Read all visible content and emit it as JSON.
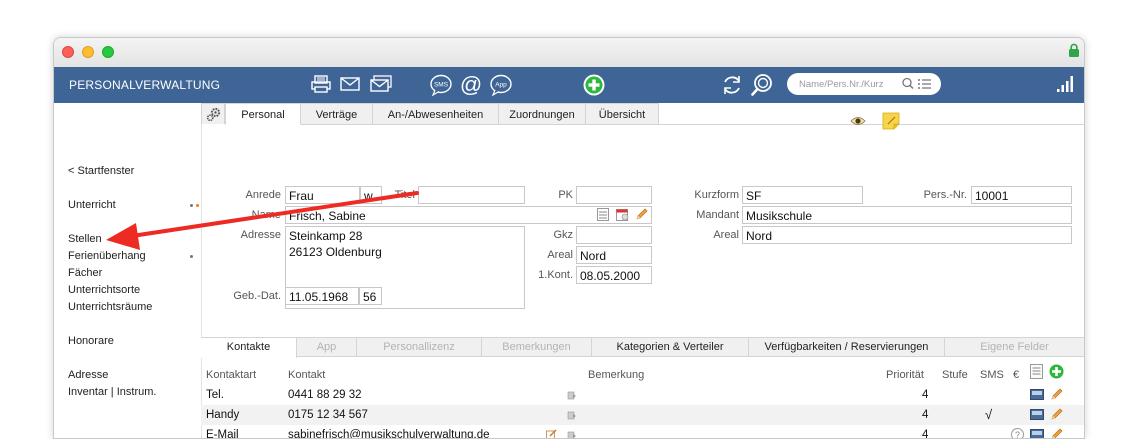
{
  "app": {
    "title": "PERSONALVERWALTUNG",
    "search_placeholder": "Name/Pers.Nr./Kurz"
  },
  "toolbar_icons": [
    "printer-icon",
    "envelope-icon",
    "envelopes-icon",
    "sms-icon",
    "at-icon",
    "app-icon",
    "add-icon",
    "refresh-icon",
    "magnifier-icon"
  ],
  "sidebar": {
    "back": "< Startfenster",
    "items": [
      "Unterricht",
      "Stellen",
      "Ferienüberhang",
      "Fächer",
      "Unterrichtsorte",
      "Unterrichtsräume",
      "Honorare",
      "Adresse",
      "Inventar | Instrum."
    ]
  },
  "tabs": [
    "Personal",
    "Verträge",
    "An-/Abwesenheiten",
    "Zuordnungen",
    "Übersicht"
  ],
  "form": {
    "anrede_label": "Anrede",
    "anrede": "Frau",
    "geschlecht": "w",
    "titel_label": "Titel",
    "titel": "",
    "pk_label": "PK",
    "pk": "",
    "name_label": "Name",
    "name": "Frisch, Sabine",
    "adresse_label": "Adresse",
    "adresse": "Steinkamp 28\n26123 Oldenburg",
    "gkz_label": "Gkz",
    "gkz": "",
    "areal_label": "Areal",
    "areal": "Nord",
    "kont_label": "1.Kont.",
    "kont": "08.05.2000",
    "gebdat_label": "Geb.-Dat.",
    "gebdat": "11.05.1968",
    "alter": "56",
    "kurzform_label": "Kurzform",
    "kurzform": "SF",
    "persnr_label": "Pers.-Nr.",
    "persnr": "10001",
    "mandant_label": "Mandant",
    "mandant": "Musikschule",
    "areal2_label": "Areal",
    "areal2": "Nord"
  },
  "bottom_tabs": [
    "Kontakte",
    "App",
    "Personallizenz",
    "Bemerkungen",
    "Kategorien & Verteiler",
    "Verfügbarkeiten / Reservierungen",
    "Eigene Felder"
  ],
  "contacts": {
    "headers": [
      "Kontaktart",
      "Kontakt",
      "Bemerkung",
      "Priorität",
      "Stufe",
      "SMS",
      "€"
    ],
    "rows": [
      {
        "art": "Tel.",
        "kontakt": "0441 88 29 32",
        "bemerkung": "",
        "prioritaet": "4",
        "sms": ""
      },
      {
        "art": "Handy",
        "kontakt": "0175 12 34 567",
        "bemerkung": "",
        "prioritaet": "4",
        "sms": "√"
      },
      {
        "art": "E-Mail",
        "kontakt": "sabinefrisch@musikschulverwaltung.de",
        "bemerkung": "",
        "prioritaet": "4",
        "sms": ""
      }
    ]
  },
  "colors": {
    "toolbar": "#3f6496",
    "arrow": "#ee2b22",
    "add_green": "#2db83d"
  }
}
